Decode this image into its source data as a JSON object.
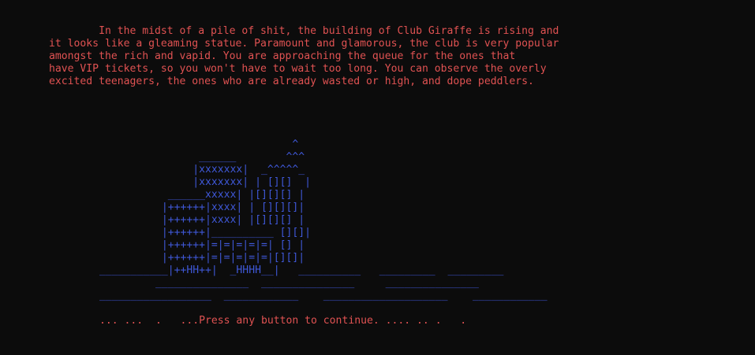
{
  "narration": {
    "text": "        In the midst of a pile of shit, the building of Club Giraffe is rising and\nit looks like a gleaming statue. Paramount and glamorous, the club is very popular\namongst the rich and vapid. You are approaching the queue for the ones that\nhave VIP tickets, so you won't have to wait too long. You can observe the overly\nexcited teenagers, the ones who are already wasted or high, and dope peddlers."
  },
  "ascii_art": {
    "text": "                               ^\n                ______        ^^^\n               |xxxxxxx|  _^^^^^_\n               |xxxxxxx| | [][]  |\n           ______xxxxx| |[][][] |\n          |++++++|xxxx| | [][][]|\n          |++++++|xxxx| |[][][] |\n          |++++++|__________ [][]|\n          |++++++|=|=|=|=|=| [] |\n          |++++++|=|=|=|=|=|[][]|\n___________|++HH++|  _HHHH__|   __________   _________  _________\n         _______________  _______________     _______________\n__________________  ____________    ____________________    ____________"
  },
  "prompt": {
    "text": "... ...  .   ...Press any button to continue. .... .. .   ."
  },
  "colors": {
    "background": "#0c0c0c",
    "narration_text": "#e05252",
    "ascii_art": "#3f58d8",
    "prompt_text": "#e05252"
  }
}
